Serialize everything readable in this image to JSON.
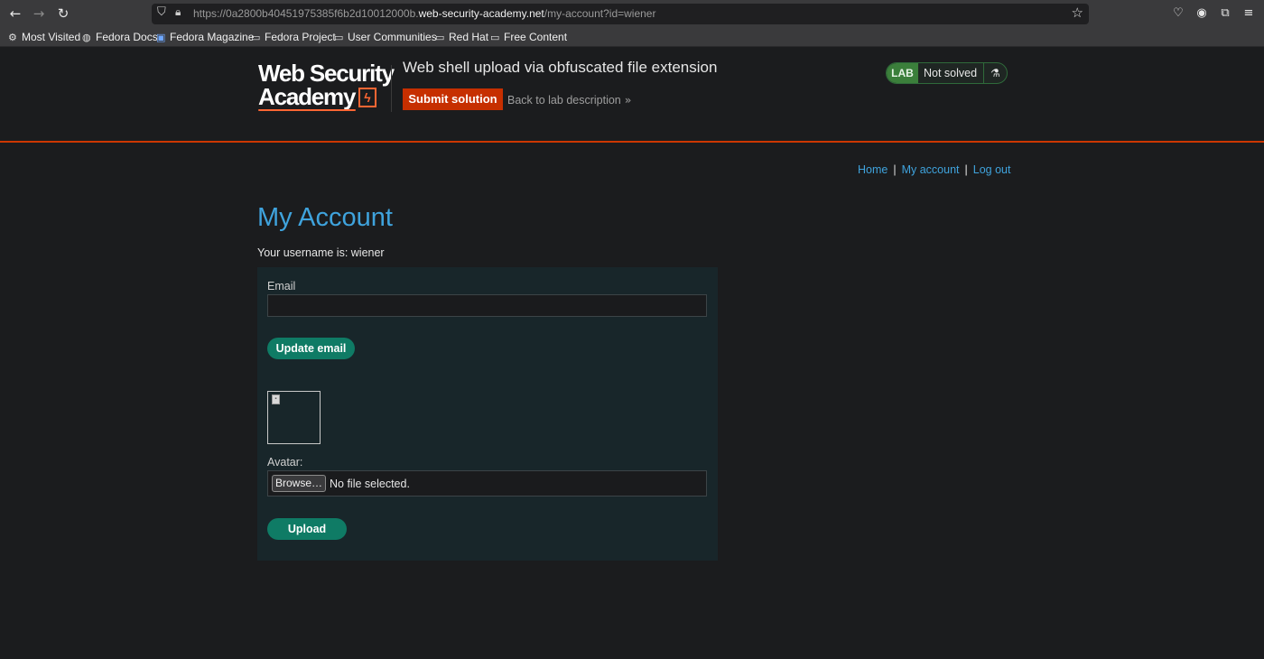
{
  "browser": {
    "back_icon": "←",
    "forward_icon": "→",
    "reload_icon": "↻",
    "url_prefix": "https://0a2800b40451975385f6b2d10012000b.",
    "url_domain": "web-security-academy.net",
    "url_path": "/my-account?id=wiener",
    "star_icon": "☆",
    "toolbar_icons": [
      "pocket-icon",
      "account-icon",
      "extensions-icon",
      "menu-icon"
    ]
  },
  "bookmarks": [
    {
      "label": "Most Visited",
      "icon": "gear-icon"
    },
    {
      "label": "Fedora Docs",
      "icon": "globe-icon"
    },
    {
      "label": "Fedora Magazine",
      "icon": "fedora-magazine-icon"
    },
    {
      "label": "Fedora Project",
      "icon": "folder-icon"
    },
    {
      "label": "User Communities",
      "icon": "folder-icon"
    },
    {
      "label": "Red Hat",
      "icon": "folder-icon"
    },
    {
      "label": "Free Content",
      "icon": "folder-icon"
    }
  ],
  "lab": {
    "logo_line1": "Web Security",
    "logo_line2": "Academy",
    "title": "Web shell upload via obfuscated file extension",
    "submit_label": "Submit solution",
    "back_label": "Back to lab description",
    "badge": "LAB",
    "status": "Not solved",
    "accent_color": "#cc3700",
    "status_color": "#3b7f3b"
  },
  "nav": {
    "home": "Home",
    "my_account": "My account",
    "log_out": "Log out",
    "separator": "|",
    "link_color": "#3fa3dd"
  },
  "account": {
    "title": "My Account",
    "username_line": "Your username is: wiener",
    "email_label": "Email",
    "email_value": "",
    "update_label": "Update email",
    "avatar_label": "Avatar:",
    "browse_label": "Browse…",
    "file_status": "No file selected.",
    "upload_label": "Upload",
    "button_color": "#0f7b65"
  }
}
